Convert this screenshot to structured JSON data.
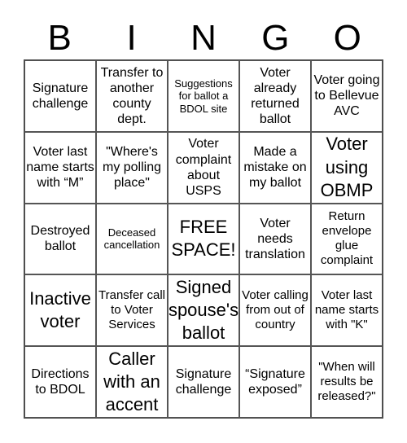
{
  "header": [
    "B",
    "I",
    "N",
    "G",
    "O"
  ],
  "cells": [
    [
      "Signature challenge",
      "Transfer to another county dept.",
      "Suggestions for ballot a BDOL site",
      "Voter already returned ballot",
      "Voter going to Bellevue AVC"
    ],
    [
      "Voter last name starts with “M”",
      "\"Where's my polling place\"",
      "Voter complaint about USPS",
      "Made a mistake on my ballot",
      "Voter using OBMP"
    ],
    [
      "Destroyed ballot",
      "Deceased cancellation",
      "FREE SPACE!",
      "Voter needs translation",
      "Return envelope glue complaint"
    ],
    [
      "Inactive voter",
      "Transfer call to Voter Services",
      "Signed spouse's ballot",
      "Voter calling from out of country",
      "Voter last name starts with \"K\""
    ],
    [
      "Directions to BDOL",
      "Caller with an accent",
      "Signature challenge",
      "“Signature exposed”",
      "\"When will results be released?\""
    ]
  ]
}
